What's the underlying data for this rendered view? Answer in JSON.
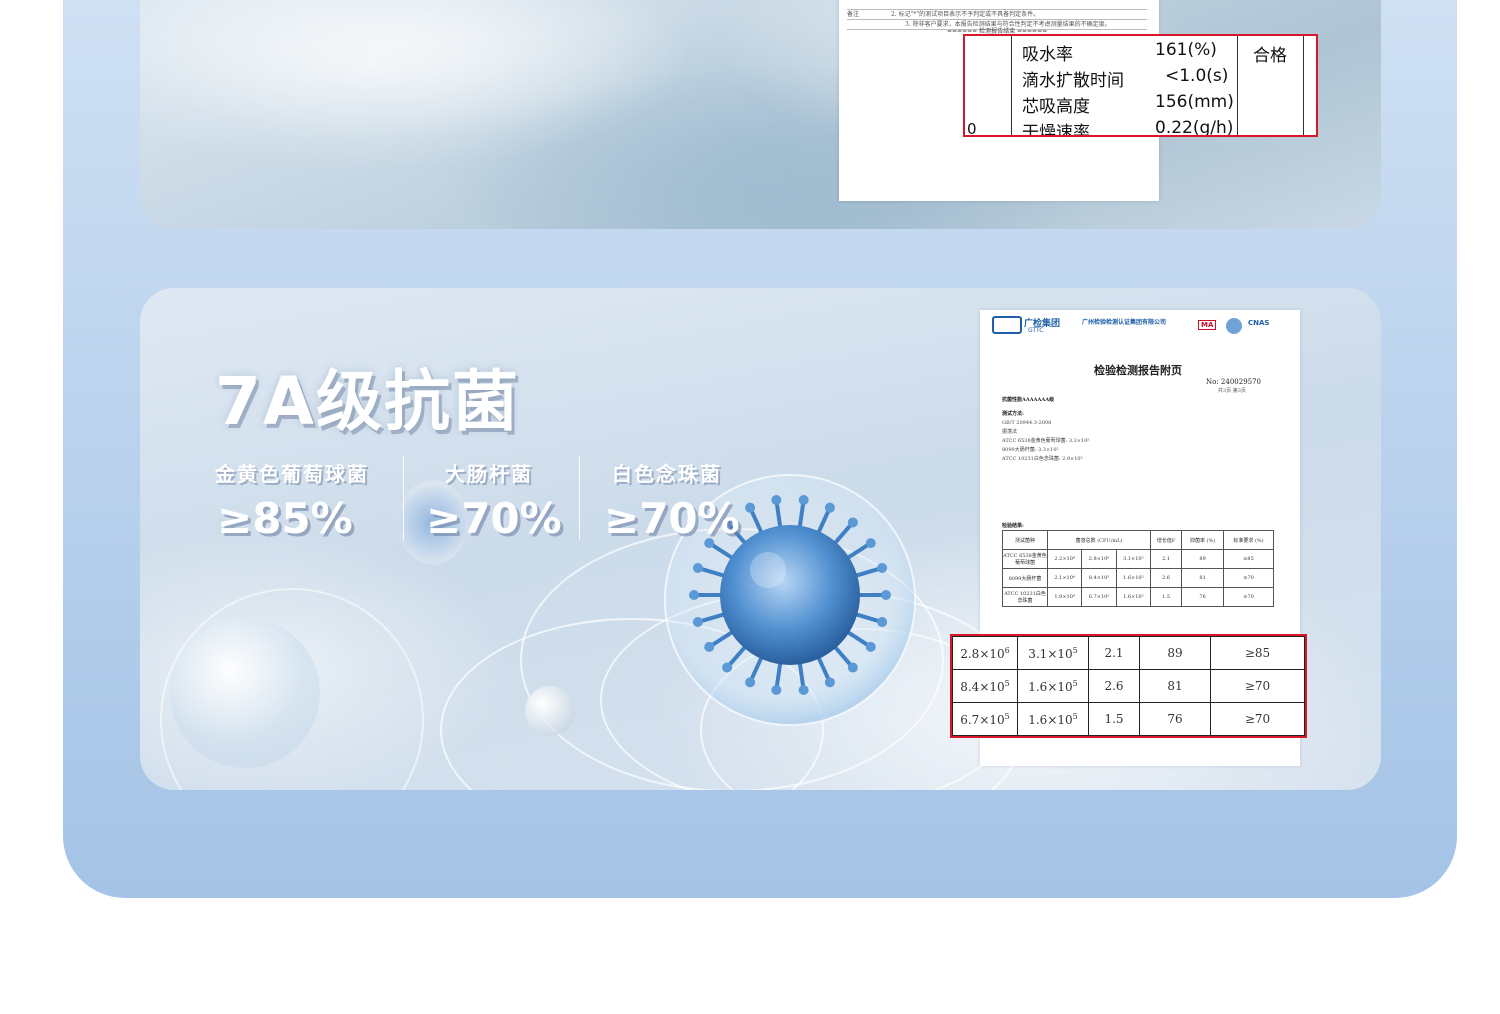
{
  "top_report": {
    "rows": [
      {
        "label": "吸水率",
        "value": "161(%)"
      },
      {
        "label": "滴水扩散时间",
        "value": "<1.0(s)"
      },
      {
        "label": "芯吸高度",
        "value": "156(mm)"
      },
      {
        "label": "干燥速率",
        "value": "0.22(g/h)"
      }
    ],
    "result": "合格",
    "left_edge_char": "0",
    "notes": [
      "2. 标记\"*\"的测试项目表示不予判定或不具备判定条件。",
      "3. 除非客户要求，本报告检测结果与符合性判定不考虑测量结果的不确定度。"
    ],
    "note_label": "备注",
    "end_mark": "====== 检测报告结束 ======"
  },
  "antibacterial": {
    "title": "7A级抗菌",
    "stats": [
      {
        "label": "金黄色葡萄球菌",
        "value": "≥85%"
      },
      {
        "label": "大肠杆菌",
        "value": "≥70%"
      },
      {
        "label": "白色念珠菌",
        "value": "≥70%"
      }
    ]
  },
  "report2": {
    "org_short": "广检集团",
    "org_en": "GTTC",
    "org_full": "广州检验检测认证集团有限公司",
    "page_title": "检验检测报告附页",
    "report_no": "No: 240029570",
    "page_info": "共3页  第3页",
    "item": "抗菌性能AAAAAAA级",
    "badges": [
      "MA",
      "CNAS"
    ],
    "method_label": "测试方法:",
    "method_lines": [
      "GB/T 20944.3-2008",
      "振荡法",
      "ATCC 6538金黄色葡萄球菌: 3.3×10⁵",
      "8099大肠杆菌: 3.3×10⁵",
      "ATCC 10231白色念珠菌: 2.9×10⁵"
    ],
    "result_label": "检验结果:",
    "mini_headers": [
      "测试菌种",
      "菌落总数 (CFU/mL)",
      "增长值F",
      "抑菌率 (%)",
      "标准要求 (%)"
    ],
    "mini_rows": [
      {
        "name": "ATCC 6538金黄色葡萄球菌",
        "c": "2.2×10⁴",
        "b": "2.8×10⁶",
        "a": "3.1×10⁵",
        "f": "2.1",
        "r": "89",
        "s": "≥85"
      },
      {
        "name": "8099大肠杆菌",
        "c": "2.1×10⁴",
        "b": "8.4×10⁵",
        "a": "1.6×10⁵",
        "f": "2.6",
        "r": "81",
        "s": "≥70"
      },
      {
        "name": "ATCC 10231白色念珠菌",
        "c": "1.9×10⁴",
        "b": "6.7×10⁵",
        "a": "1.6×10⁵",
        "f": "1.5",
        "r": "76",
        "s": "≥70"
      }
    ]
  },
  "highlight_table": [
    {
      "before": "2.8×10",
      "before_exp": "6",
      "after": "3.1×10",
      "after_exp": "5",
      "growth": "2.1",
      "rate": "89",
      "req": "≥85"
    },
    {
      "before": "8.4×10",
      "before_exp": "5",
      "after": "1.6×10",
      "after_exp": "5",
      "growth": "2.6",
      "rate": "81",
      "req": "≥70"
    },
    {
      "before": "6.7×10",
      "before_exp": "5",
      "after": "1.6×10",
      "after_exp": "5",
      "growth": "1.5",
      "rate": "76",
      "req": "≥70"
    }
  ]
}
